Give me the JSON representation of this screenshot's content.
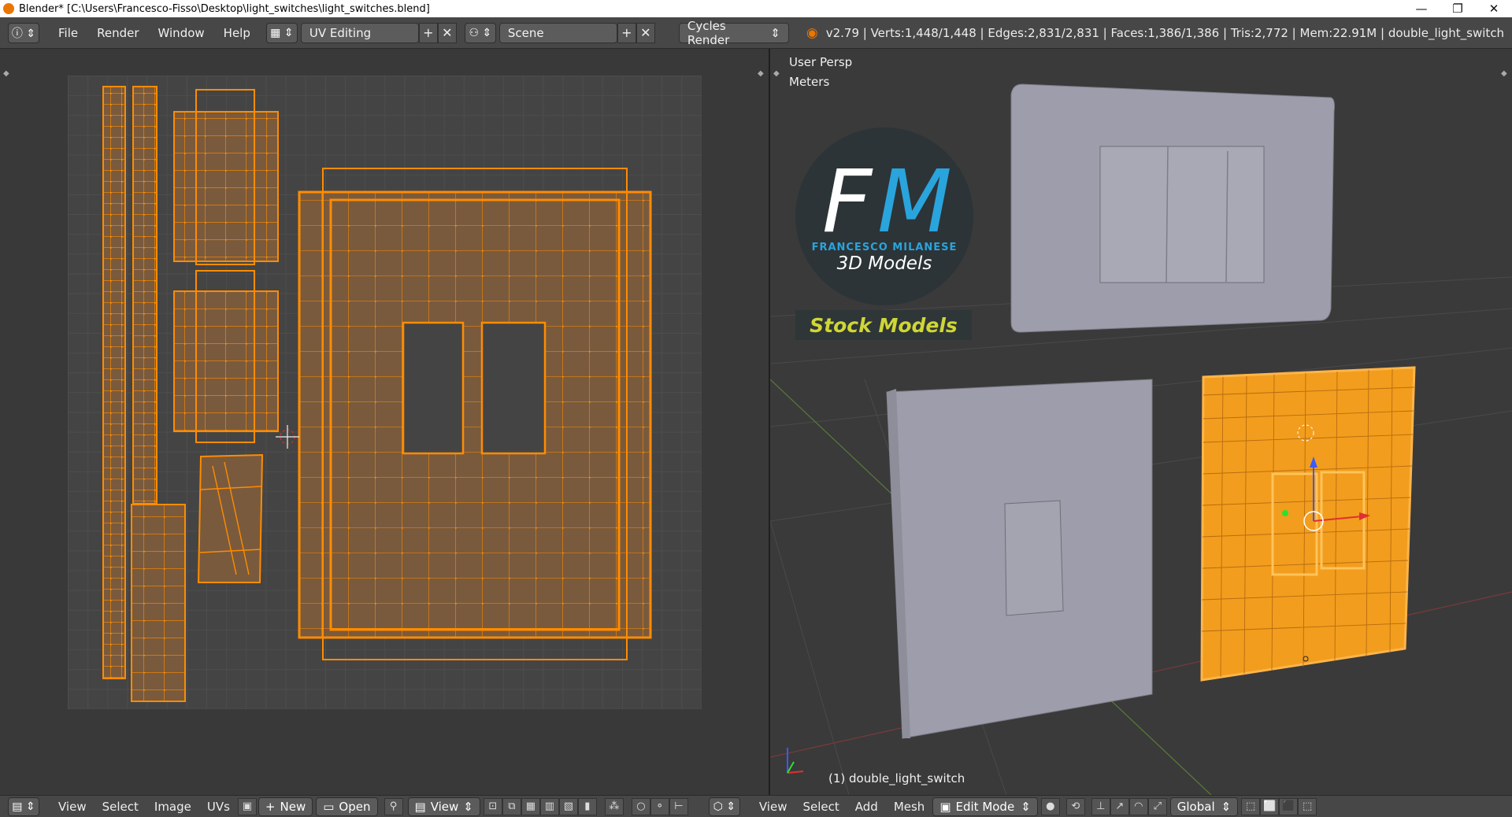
{
  "window": {
    "title": "Blender* [C:\\Users\\Francesco-Fisso\\Desktop\\light_switches\\light_switches.blend]",
    "controls": [
      "—",
      "❐",
      "✕"
    ]
  },
  "infobar": {
    "menus": [
      "File",
      "Render",
      "Window",
      "Help"
    ],
    "screen_layout": "UV Editing",
    "scene": "Scene",
    "render_engine": "Cycles Render",
    "stats": "v2.79 | Verts:1,448/1,448 | Edges:2,831/2,831 | Faces:1,386/1,386 | Tris:2,772 | Mem:22.91M | double_light_switch"
  },
  "viewport": {
    "view_name": "User Persp",
    "units": "Meters",
    "object_label": "(1) double_light_switch"
  },
  "logo": {
    "letter_f": "F",
    "letter_m": "M",
    "name": "FRANCESCO MILANESE",
    "subtitle": "3D Models",
    "banner": "Stock Models"
  },
  "uv_bottom": {
    "menus": [
      "View",
      "Select",
      "Image",
      "UVs"
    ],
    "new_label": "New",
    "open_label": "Open",
    "view_label": "View"
  },
  "vp_bottom": {
    "menus": [
      "View",
      "Select",
      "Add",
      "Mesh"
    ],
    "mode": "Edit Mode",
    "orientation": "Global"
  },
  "colors": {
    "uv_island_fill": "#7a5a3c",
    "uv_edge": "#ff8c00",
    "selected_mesh": "#f29d1d",
    "mesh_gray": "#9a9aa8",
    "logo_blue": "#2aa4dc",
    "logo_yellow": "#d0d634"
  }
}
